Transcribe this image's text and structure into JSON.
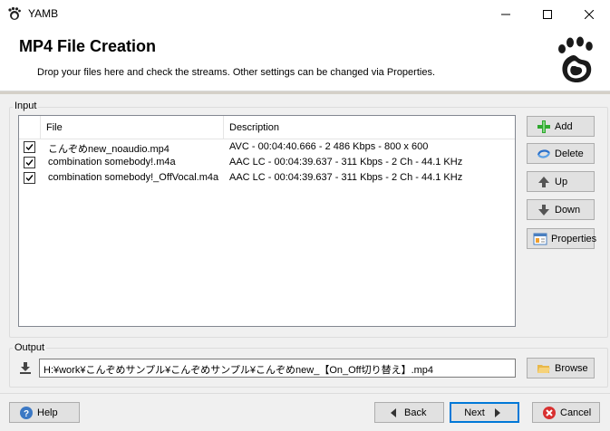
{
  "window": {
    "title": "YAMB"
  },
  "header": {
    "title": "MP4 File Creation",
    "subtitle": "Drop your files here and check the streams. Other settings can be changed via Properties."
  },
  "input": {
    "label": "Input",
    "columns": [
      "File",
      "Description"
    ],
    "rows": [
      {
        "checked": true,
        "file": "こんぞめnew_noaudio.mp4",
        "description": "AVC - 00:04:40.666 - 2 486 Kbps - 800 x 600"
      },
      {
        "checked": true,
        "file": "combination somebody!.m4a",
        "description": "AAC LC - 00:04:39.637 - 311 Kbps - 2 Ch - 44.1 KHz"
      },
      {
        "checked": true,
        "file": "combination somebody!_OffVocal.m4a",
        "description": "AAC LC - 00:04:39.637 - 311 Kbps - 2 Ch - 44.1 KHz"
      }
    ],
    "buttons": {
      "add": "Add",
      "delete": "Delete",
      "up": "Up",
      "down": "Down",
      "properties": "Properties"
    }
  },
  "output": {
    "label": "Output",
    "path": "H:¥work¥こんぞめサンプル¥こんぞめサンプル¥こんぞめnew_【On_Off切り替え】.mp4",
    "browse": "Browse"
  },
  "footer": {
    "help": "Help",
    "back": "Back",
    "next": "Next",
    "cancel": "Cancel"
  }
}
